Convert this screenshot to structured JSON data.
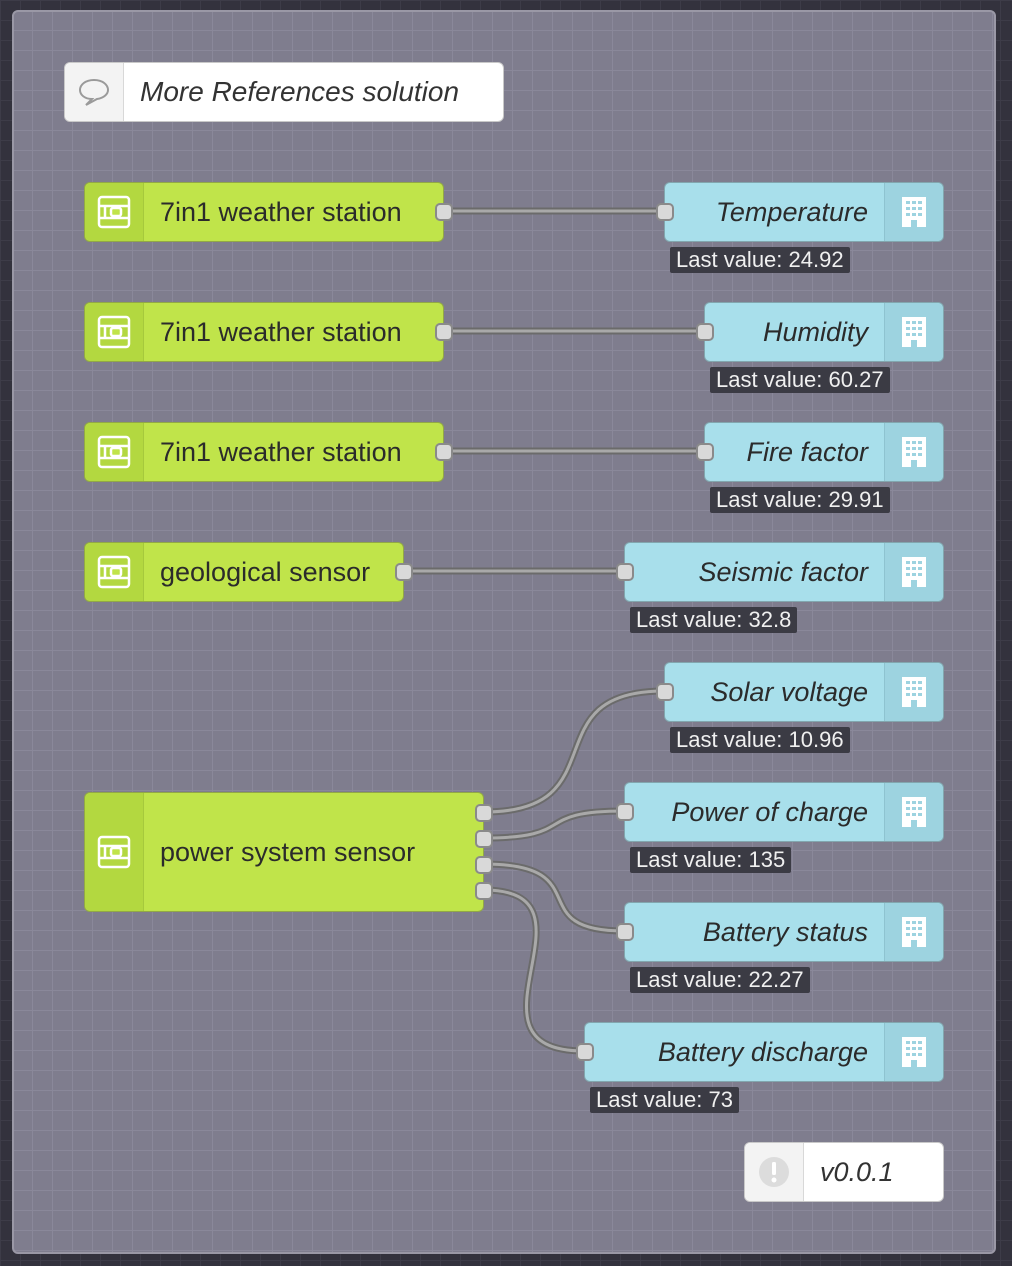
{
  "comment": {
    "label": "More References solution",
    "icon": "comment-icon"
  },
  "rows": [
    {
      "source": "7in1 weather station",
      "target": "Temperature",
      "status": "Last value: 24.92"
    },
    {
      "source": "7in1 weather station",
      "target": "Humidity",
      "status": "Last value: 60.27"
    },
    {
      "source": "7in1 weather station",
      "target": "Fire factor",
      "status": "Last value: 29.91"
    },
    {
      "source": "geological sensor",
      "target": "Seismic factor",
      "status": "Last value: 32.8"
    }
  ],
  "power": {
    "source": "power system sensor",
    "outputs": [
      {
        "target": "Solar voltage",
        "status": "Last value: 10.96"
      },
      {
        "target": "Power of charge",
        "status": "Last value: 135"
      },
      {
        "target": "Battery status",
        "status": "Last value: 22.27"
      },
      {
        "target": "Battery discharge",
        "status": "Last value: 73"
      }
    ]
  },
  "version": {
    "label": "v0.0.1",
    "icon": "alert-icon"
  },
  "colors": {
    "sensor": "#c0e44a",
    "output": "#a8dfeb",
    "group": "#7f7d8e",
    "status_bg": "#3b3b44"
  }
}
